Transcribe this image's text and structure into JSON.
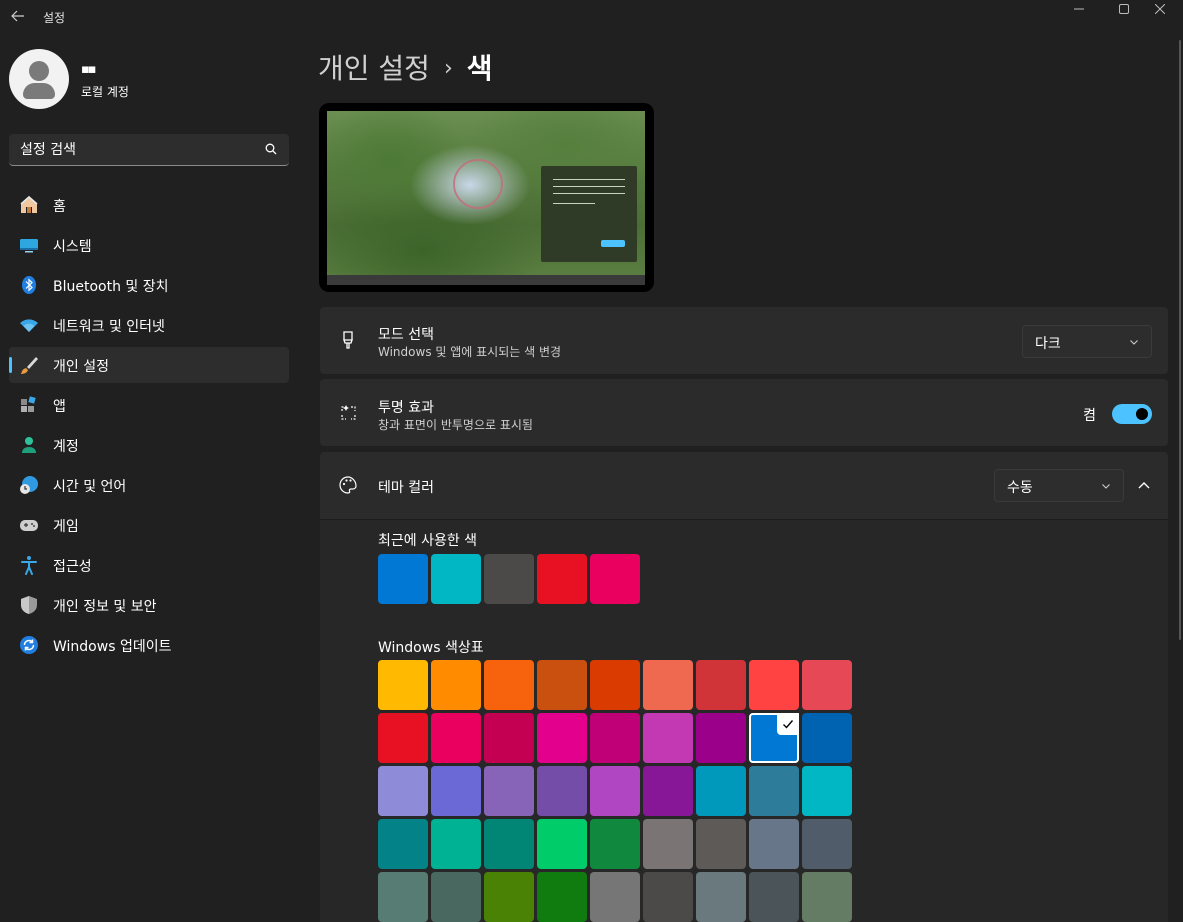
{
  "window": {
    "title": "설정",
    "back_icon": "back-arrow-icon",
    "controls": [
      "minimize-icon",
      "maximize-icon",
      "close-icon"
    ]
  },
  "user": {
    "name": "▪▪",
    "account_type": "로컬 계정"
  },
  "search": {
    "placeholder": "설정 검색"
  },
  "sidebar": {
    "items": [
      {
        "label": "홈",
        "icon": "home-icon",
        "name": "sidebar-item-home",
        "active": false
      },
      {
        "label": "시스템",
        "icon": "system-icon",
        "name": "sidebar-item-system",
        "active": false
      },
      {
        "label": "Bluetooth 및 장치",
        "icon": "bluetooth-icon",
        "name": "sidebar-item-bluetooth",
        "active": false
      },
      {
        "label": "네트워크 및 인터넷",
        "icon": "wifi-icon",
        "name": "sidebar-item-network",
        "active": false
      },
      {
        "label": "개인 설정",
        "icon": "brush-icon",
        "name": "sidebar-item-personalization",
        "active": true
      },
      {
        "label": "앱",
        "icon": "apps-icon",
        "name": "sidebar-item-apps",
        "active": false
      },
      {
        "label": "계정",
        "icon": "account-icon",
        "name": "sidebar-item-accounts",
        "active": false
      },
      {
        "label": "시간 및 언어",
        "icon": "globe-clock-icon",
        "name": "sidebar-item-time-language",
        "active": false
      },
      {
        "label": "게임",
        "icon": "gamepad-icon",
        "name": "sidebar-item-gaming",
        "active": false
      },
      {
        "label": "접근성",
        "icon": "accessibility-icon",
        "name": "sidebar-item-accessibility",
        "active": false
      },
      {
        "label": "개인 정보 및 보안",
        "icon": "shield-icon",
        "name": "sidebar-item-privacy",
        "active": false
      },
      {
        "label": "Windows 업데이트",
        "icon": "update-icon",
        "name": "sidebar-item-update",
        "active": false
      }
    ]
  },
  "breadcrumb": {
    "parent": "개인 설정",
    "separator": "›",
    "current": "색"
  },
  "mode": {
    "title": "모드 선택",
    "subtitle": "Windows 및 앱에 표시되는 색 변경",
    "value": "다크",
    "icon": "brush-mode-icon"
  },
  "transparency": {
    "title": "투명 효과",
    "subtitle": "창과 표면이 반투명으로 표시됨",
    "state_label": "켬",
    "on": true,
    "icon": "sparkle-icon"
  },
  "accent": {
    "title": "테마 컬러",
    "value": "수동",
    "icon": "palette-icon",
    "recent_label": "최근에 사용한 색",
    "recent_colors": [
      "#0078d4",
      "#00b7c3",
      "#4c4a48",
      "#e81123",
      "#ea005e"
    ],
    "palette_label": "Windows 색상표",
    "selected_color": "#0078d4",
    "palette": [
      [
        "#ffb900",
        "#ff8c00",
        "#f7630c",
        "#ca5010",
        "#da3b01",
        "#ef6950",
        "#d13438",
        "#ff4343",
        "#e74856"
      ],
      [
        "#e81123",
        "#ea005e",
        "#c30052",
        "#e3008c",
        "#bf0077",
        "#c239b3",
        "#9a0089",
        "#0078d4",
        "#0063b1"
      ],
      [
        "#8e8cd8",
        "#6b69d6",
        "#8764b8",
        "#744da9",
        "#b146c2",
        "#881798",
        "#0099bc",
        "#2d7d9a",
        "#00b7c3"
      ],
      [
        "#038387",
        "#00b294",
        "#018574",
        "#00cc6a",
        "#10893e",
        "#7a7574",
        "#5d5a58",
        "#68768a",
        "#515c6b"
      ],
      [
        "#567c73",
        "#486860",
        "#498205",
        "#107c10",
        "#767676",
        "#4c4a48",
        "#69797e",
        "#4a5459",
        "#647c64"
      ]
    ]
  },
  "colors": {
    "accent_ui": "#4cc2ff",
    "background": "#202020",
    "card": "#2b2b2b"
  }
}
